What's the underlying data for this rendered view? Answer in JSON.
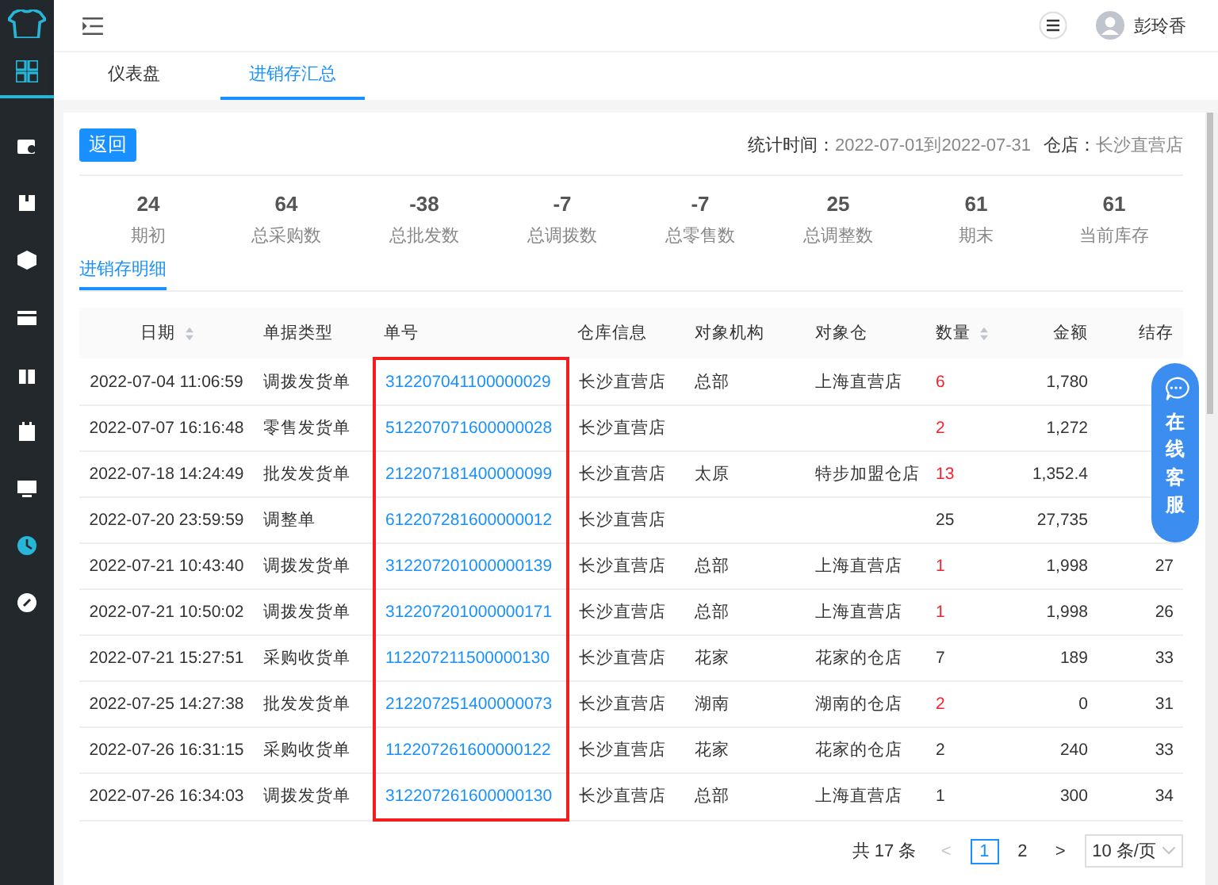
{
  "sidebar": {
    "items": [
      {
        "selected": false
      },
      {
        "selected": false
      },
      {
        "selected": false
      },
      {
        "selected": false
      },
      {
        "selected": false
      },
      {
        "selected": false
      },
      {
        "selected": false
      },
      {
        "selected": true
      },
      {
        "selected": false
      }
    ]
  },
  "header": {
    "user": "彭玲香"
  },
  "tabs": [
    {
      "label": "仪表盘",
      "selected": false
    },
    {
      "label": "进销存汇总",
      "selected": true
    }
  ],
  "back_button": "返回",
  "filter": {
    "period_label": "统计时间：",
    "period": "2022-07-01到2022-07-31",
    "store_label": "仓店：",
    "store": "长沙直营店"
  },
  "stats": [
    {
      "value": "24",
      "label": "期初"
    },
    {
      "value": "64",
      "label": "总采购数"
    },
    {
      "value": "-38",
      "label": "总批发数"
    },
    {
      "value": "-7",
      "label": "总调拨数"
    },
    {
      "value": "-7",
      "label": "总零售数"
    },
    {
      "value": "25",
      "label": "总调整数"
    },
    {
      "value": "61",
      "label": "期末"
    },
    {
      "value": "61",
      "label": "当前库存"
    }
  ],
  "subtab": "进销存明细",
  "table": {
    "columns": [
      {
        "label": "日期",
        "sortable": true,
        "highlighted": false
      },
      {
        "label": "单据类型",
        "sortable": false,
        "highlighted": false
      },
      {
        "label": "单号",
        "sortable": false,
        "highlighted": true
      },
      {
        "label": "仓库信息",
        "sortable": false,
        "highlighted": false
      },
      {
        "label": "对象机构",
        "sortable": false,
        "highlighted": false
      },
      {
        "label": "对象仓",
        "sortable": false,
        "highlighted": false
      },
      {
        "label": "数量",
        "sortable": true,
        "highlighted": false
      },
      {
        "label": "金额",
        "sortable": false,
        "highlighted": false
      },
      {
        "label": "结存",
        "sortable": false,
        "highlighted": false
      }
    ],
    "rows": [
      {
        "date": "2022-07-04 11:06:59",
        "type": "调拨发货单",
        "no": "312207041100000029",
        "warehouse": "长沙直营店",
        "org": "总部",
        "target": "上海直营店",
        "qty": "6",
        "outgoing": true,
        "amount": "1,780"
      },
      {
        "date": "2022-07-07 16:16:48",
        "type": "零售发货单",
        "no": "512207071600000028",
        "warehouse": "长沙直营店",
        "qty": "2",
        "outgoing": true,
        "amount": "1,272"
      },
      {
        "date": "2022-07-18 14:24:49",
        "type": "批发发货单",
        "no": "212207181400000099",
        "warehouse": "长沙直营店",
        "org": "太原",
        "target": "特步加盟仓店",
        "qty": "13",
        "outgoing": true,
        "amount": "1,352.4"
      },
      {
        "date": "2022-07-20 23:59:59",
        "type": "调整单",
        "no": "612207281600000012",
        "warehouse": "长沙直营店",
        "qty": "25",
        "outgoing": false,
        "amount": "27,735"
      },
      {
        "date": "2022-07-21 10:43:40",
        "type": "调拨发货单",
        "no": "312207201000000139",
        "warehouse": "长沙直营店",
        "org": "总部",
        "target": "上海直营店",
        "qty": "1",
        "outgoing": true,
        "amount": "1,998",
        "balance": "27"
      },
      {
        "date": "2022-07-21 10:50:02",
        "type": "调拨发货单",
        "no": "312207201000000171",
        "warehouse": "长沙直营店",
        "org": "总部",
        "target": "上海直营店",
        "qty": "1",
        "outgoing": true,
        "amount": "1,998",
        "balance": "26"
      },
      {
        "date": "2022-07-21 15:27:51",
        "type": "采购收货单",
        "no": "112207211500000130",
        "warehouse": "长沙直营店",
        "org": "花家",
        "target": "花家的仓店",
        "qty": "7",
        "outgoing": false,
        "amount": "189",
        "balance": "33"
      },
      {
        "date": "2022-07-25 14:27:38",
        "type": "批发发货单",
        "no": "212207251400000073",
        "warehouse": "长沙直营店",
        "org": "湖南",
        "target": "湖南的仓店",
        "qty": "2",
        "outgoing": true,
        "amount": "0",
        "balance": "31"
      },
      {
        "date": "2022-07-26 16:31:15",
        "type": "采购收货单",
        "no": "112207261600000122",
        "warehouse": "长沙直营店",
        "org": "花家",
        "target": "花家的仓店",
        "qty": "2",
        "outgoing": false,
        "amount": "240",
        "balance": "33"
      },
      {
        "date": "2022-07-26 16:34:03",
        "type": "调拨发货单",
        "no": "312207261600000130",
        "warehouse": "长沙直营店",
        "org": "总部",
        "target": "上海直营店",
        "qty": "1",
        "outgoing": false,
        "amount": "300",
        "balance": "34"
      }
    ]
  },
  "pagination": {
    "total": "共 17 条",
    "prev": "<",
    "pages": [
      {
        "label": "1",
        "selected": true
      },
      {
        "label": "2",
        "selected": false
      }
    ],
    "next": ">",
    "page_size": "10 条/页"
  },
  "chat_widget": {
    "label": "在线客服"
  }
}
